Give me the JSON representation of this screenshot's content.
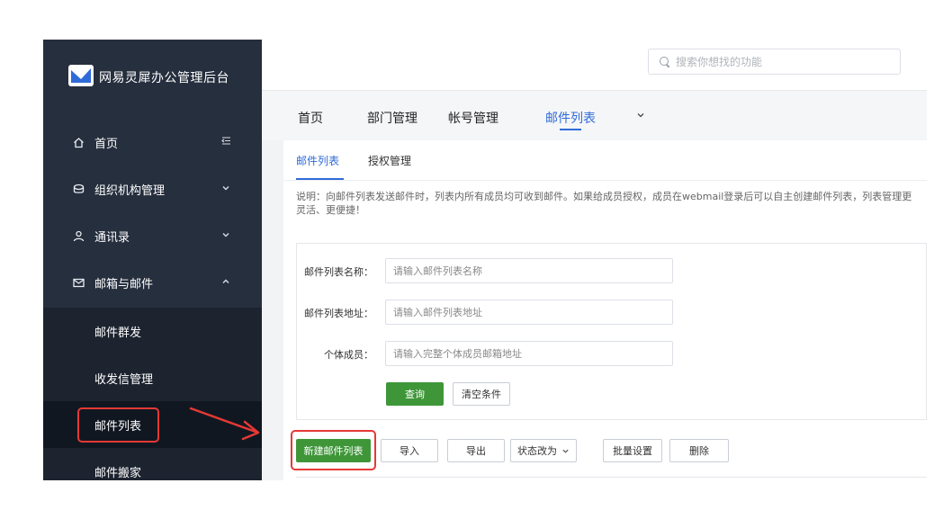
{
  "app": {
    "title": "网易灵犀办公管理后台"
  },
  "sidebar": {
    "items": [
      {
        "label": "首页",
        "icon": "home-icon",
        "arrow": "menu-collapse-icon"
      },
      {
        "label": "组织机构管理",
        "icon": "org-icon",
        "arrow": "chevron-down-icon"
      },
      {
        "label": "通讯录",
        "icon": "contacts-icon",
        "arrow": "chevron-down-icon"
      },
      {
        "label": "邮箱与邮件",
        "icon": "mail-icon",
        "arrow": "chevron-up-icon"
      }
    ],
    "sub_items": [
      {
        "label": "邮件群发"
      },
      {
        "label": "收发信管理"
      },
      {
        "label": "邮件列表",
        "active": true
      },
      {
        "label": "邮件搬家"
      }
    ]
  },
  "header": {
    "search_placeholder": "搜索你想找的功能"
  },
  "main_tabs": [
    {
      "label": "首页"
    },
    {
      "label": "部门管理"
    },
    {
      "label": "帐号管理"
    },
    {
      "label": "邮件列表",
      "active": true
    }
  ],
  "sub_tabs": [
    {
      "label": "邮件列表",
      "active": true
    },
    {
      "label": "授权管理"
    }
  ],
  "description": "说明：向邮件列表发送邮件时，列表内所有成员均可收到邮件。如果给成员授权，成员在webmail登录后可以自主创建邮件列表，列表管理更灵活、更便捷！",
  "form": {
    "fields": [
      {
        "label": "邮件列表名称：",
        "placeholder": "请输入邮件列表名称",
        "value": ""
      },
      {
        "label": "邮件列表地址：",
        "placeholder": "请输入邮件列表地址",
        "value": ""
      },
      {
        "label": "个体成员：",
        "placeholder": "请输入完整个体成员邮箱地址",
        "value": ""
      }
    ],
    "query_label": "查询",
    "clear_label": "清空条件"
  },
  "actions": {
    "new_list": "新建邮件列表",
    "import": "导入",
    "export": "导出",
    "status_change": "状态改为",
    "batch_settings": "批量设置",
    "delete": "删除"
  },
  "colors": {
    "accent": "#2f6bd8",
    "primary_button": "#3f9639",
    "sidebar_bg": "#262f3e",
    "highlight": "#e53935"
  }
}
